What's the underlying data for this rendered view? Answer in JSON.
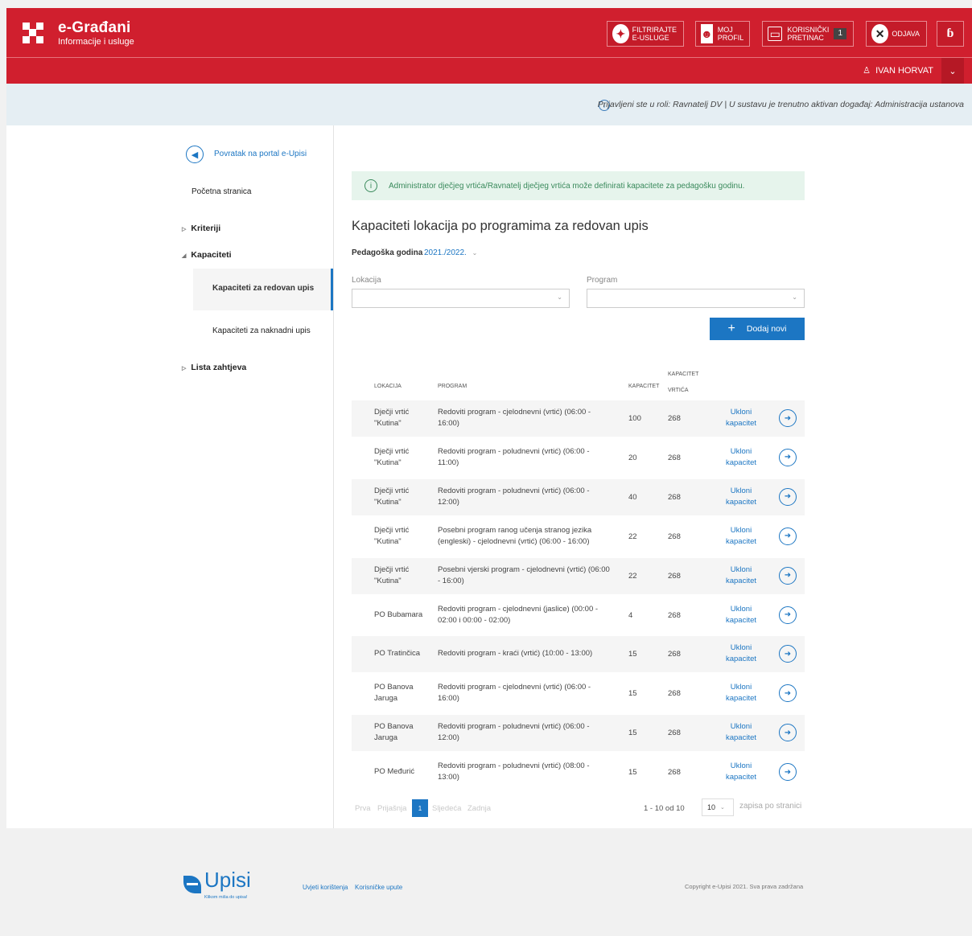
{
  "colors": {
    "brand_red": "#d01f2e",
    "accent_blue": "#1c76c3",
    "success_green": "#3a8a5c"
  },
  "header": {
    "app_title": "e-Građani",
    "app_subtitle": "Informacije i usluge",
    "filter_btn": [
      "FILTRIRAJTE",
      "E-USLUGE"
    ],
    "profile_btn": [
      "MOJ",
      "PROFIL"
    ],
    "inbox_btn": [
      "KORISNIČKI",
      "PRETINAC"
    ],
    "inbox_count": "1",
    "logout_btn": "ODJAVA",
    "user_name": "IVAN HORVAT",
    "icons": [
      "filter-icon",
      "profile-icon",
      "inbox-icon",
      "close-icon",
      "accessibility-icon",
      "chevron-down-icon"
    ]
  },
  "info_bar": {
    "text": "Prijavljeni ste u roli: Ravnatelj DV | U sustavu je trenutno aktivan događaj: Administracija ustanova"
  },
  "sidebar": {
    "back_label": "Povratak na portal e-Upisi",
    "home": "Početna stranica",
    "criteria": "Kriteriji",
    "capacities": "Kapaciteti",
    "sub_regular": "Kapaciteti za redovan upis",
    "sub_late": "Kapaciteti za naknadni upis",
    "requests": "Lista zahtjeva"
  },
  "main": {
    "alert": "Administrator dječjeg vrtića/Ravnatelj dječjeg vrtića može definirati kapacitete za pedagošku godinu.",
    "title": "Kapaciteti lokacija po programima za redovan upis",
    "year_label": "Pedagoška godina",
    "year_value": "2021./2022.",
    "location_label": "Lokacija",
    "program_label": "Program",
    "add_button": "Dodaj novi",
    "columns": [
      "LOKACIJA",
      "PROGRAM",
      "KAPACITET",
      "KAPACITET",
      "VRTIĆA"
    ],
    "remove_line1": "Ukloni",
    "remove_line2": "kapacitet",
    "rows": [
      {
        "loc1": "Dječji vrtić",
        "loc2": "\"Kutina\"",
        "prog1": "Redoviti program - cjelodnevni (vrtić) (06:00 -",
        "prog2": "16:00)",
        "cap": "100",
        "kcap": "268"
      },
      {
        "loc1": "Dječji vrtić",
        "loc2": "\"Kutina\"",
        "prog1": "Redoviti program - poludnevni (vrtić) (06:00 -",
        "prog2": "11:00)",
        "cap": "20",
        "kcap": "268"
      },
      {
        "loc1": "Dječji vrtić",
        "loc2": "\"Kutina\"",
        "prog1": "Redoviti program - poludnevni (vrtić) (06:00 -",
        "prog2": "12:00)",
        "cap": "40",
        "kcap": "268"
      },
      {
        "loc1": "Dječji vrtić",
        "loc2": "\"Kutina\"",
        "prog1": "Posebni program ranog učenja stranog jezika",
        "prog2": "(engleski) - cjelodnevni (vrtić) (06:00 - 16:00)",
        "cap": "22",
        "kcap": "268"
      },
      {
        "loc1": "Dječji vrtić",
        "loc2": "\"Kutina\"",
        "prog1": "Posebni vjerski program - cjelodnevni (vrtić) (06:00",
        "prog2": "- 16:00)",
        "cap": "22",
        "kcap": "268"
      },
      {
        "loc1": "PO Bubamara",
        "loc2": "",
        "prog1": "Redoviti program - cjelodnevni (jaslice) (00:00 -",
        "prog2": "02:00 i 00:00 - 02:00)",
        "cap": "4",
        "kcap": "268"
      },
      {
        "loc1": "PO Tratinčica",
        "loc2": "",
        "prog1": "Redoviti program - kraći (vrtić) (10:00 - 13:00)",
        "prog2": "",
        "cap": "15",
        "kcap": "268"
      },
      {
        "loc1": "PO Banova",
        "loc2": "Jaruga",
        "prog1": "Redoviti program - cjelodnevni (vrtić) (06:00 -",
        "prog2": "16:00)",
        "cap": "15",
        "kcap": "268"
      },
      {
        "loc1": "PO Banova",
        "loc2": "Jaruga",
        "prog1": "Redoviti program - poludnevni (vrtić) (06:00 -",
        "prog2": "12:00)",
        "cap": "15",
        "kcap": "268"
      },
      {
        "loc1": "PO Međurić",
        "loc2": "",
        "prog1": "Redoviti program - poludnevni (vrtić) (08:00 -",
        "prog2": "13:00)",
        "cap": "15",
        "kcap": "268"
      }
    ],
    "pager": {
      "first": "Prva",
      "prev": "Prijašnja",
      "current": "1",
      "next": "Sljedeća",
      "last": "Zadnja",
      "range": "1 - 10 od 10",
      "per_page": "10",
      "per_page_text": "zapisa po stranici"
    }
  },
  "footer": {
    "logo_word": "Upisi",
    "logo_tag": "Klikom miša do upisa!",
    "terms": "Uvjeti korištenja",
    "guide": "Korisničke upute",
    "copyright": "Copyright e-Upisi 2021. Sva prava zadržana"
  }
}
